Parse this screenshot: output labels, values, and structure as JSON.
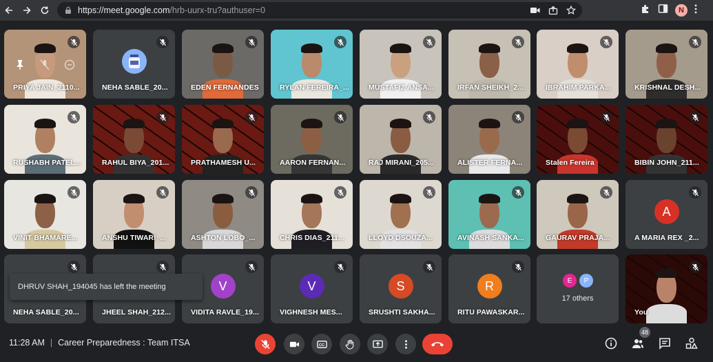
{
  "browser": {
    "url_host": "https://meet.google.com",
    "url_path": "/hrb-uurx-tru?authuser=0",
    "profile_initial": "N"
  },
  "participants": [
    {
      "name": "PRIYA JAIN_2110...",
      "bg": "#b49478",
      "skin": "#c79a7e",
      "shirt": "#eee8e0"
    },
    {
      "name": "NEHA SABLE_20...",
      "avatar": true
    },
    {
      "name": "EDEN FERNANDES",
      "bg": "#6c6a66",
      "skin": "#7b5a45",
      "shirt": "#e06a3a"
    },
    {
      "name": "RYLAN FEREIRA_...",
      "bg": "#60c5d0",
      "skin": "#b98a6b",
      "shirt": "#e9e6e0"
    },
    {
      "name": "MUSTAFIZ ANSA...",
      "bg": "#c8c4bc",
      "skin": "#c9a17f",
      "shirt": "#f0f0f0"
    },
    {
      "name": "IRFAN SHEIKH_2...",
      "bg": "#c7c0b5",
      "skin": "#8a6048",
      "shirt": "#bdb7ac"
    },
    {
      "name": "IBRAHIM PARKA...",
      "bg": "#d9cfc6",
      "skin": "#c08d6d",
      "shirt": "#e4e0da"
    },
    {
      "name": "KRISHNAL DESH...",
      "bg": "#a49b8c",
      "skin": "#8f6047",
      "shirt": "#2f2c2c"
    },
    {
      "name": "RUSHABH PATEL...",
      "bg": "#e9e5dc",
      "skin": "#b08062",
      "shirt": "#5c6e78"
    },
    {
      "name": "RAHUL BIYA_201...",
      "bg": "#6a1a12",
      "skin": "#7a4a35",
      "shirt": "#333"
    },
    {
      "name": "PRATHAMESH U...",
      "bg": "#6a1a12",
      "skin": "#9a6a4e",
      "shirt": "#222"
    },
    {
      "name": "AARON FERNAN...",
      "bg": "#6d6a60",
      "skin": "#8c5e43",
      "shirt": "#363636"
    },
    {
      "name": "RAJ MIRANI_205...",
      "bg": "#bdb6ab",
      "skin": "#8a5c42",
      "shirt": "#2a2a2a"
    },
    {
      "name": "ALISTER FERNA...",
      "bg": "#8c8478",
      "skin": "#9a6a4c",
      "shirt": "#e9e9e9"
    },
    {
      "name": "Stalen Fereira",
      "bg": "#4a0f0c",
      "skin": "#7a4a33",
      "shirt": "#c9342b"
    },
    {
      "name": "BIBIN JOHN_211...",
      "bg": "#4a0f0c",
      "skin": "#6a432e",
      "shirt": "#333"
    },
    {
      "name": "VINIT BHAMARE...",
      "bg": "#e8e6e0",
      "skin": "#8d6148",
      "shirt": "#d6c9a2"
    },
    {
      "name": "ANSHU TIWARI_...",
      "bg": "#d8cfc4",
      "skin": "#c28e70",
      "shirt": "#111"
    },
    {
      "name": "ASHTON LOBO_...",
      "bg": "#8f8b84",
      "skin": "#8a5c40",
      "shirt": "#d8d8d8"
    },
    {
      "name": "CHRIS DIAS_211...",
      "bg": "#e6e1d8",
      "skin": "#a57658",
      "shirt": "#1e1e24"
    },
    {
      "name": "LLOYD DSOUZA...",
      "bg": "#ded9d0",
      "skin": "#a07050",
      "shirt": "#e2e2e2"
    },
    {
      "name": "AVINASH SANKA...",
      "bg": "#5dc0b2",
      "skin": "#9c6a4e",
      "shirt": "#dcdcdc"
    },
    {
      "name": "GAURAV PRAJA...",
      "bg": "#cfc8bc",
      "skin": "#9a6649",
      "shirt": "#c23a2a"
    },
    {
      "name": "A MARIA REX _2...",
      "avatar": true,
      "initial": "A",
      "color": "#d93025"
    },
    {
      "name": "NEHA SABLE_20...",
      "avatar": false,
      "plain": true
    },
    {
      "name": "JHEEL SHAH_212...",
      "avatar": false,
      "plain": true
    },
    {
      "name": "VIDITA RAVLE_19...",
      "avatar": true,
      "initial": "V",
      "color": "#a142c9"
    },
    {
      "name": "VIGHNESH MES...",
      "avatar": true,
      "initial": "V",
      "color": "#5b2bb5"
    },
    {
      "name": "SRUSHTI SAKHA...",
      "avatar": true,
      "initial": "S",
      "color": "#d64a25"
    },
    {
      "name": "RITU PAWASKAR...",
      "avatar": true,
      "initial": "R",
      "color": "#f07d1e"
    },
    {
      "name": "",
      "others": true
    },
    {
      "name": "You",
      "bg": "#2a0907",
      "skin": "#b88368",
      "shirt": "#dcdcdc",
      "self": true
    }
  ],
  "others": {
    "label": "17 others",
    "initials": [
      "E",
      "P"
    ],
    "colors": [
      "#e52592",
      "#8ab4f8"
    ]
  },
  "toast": "DHRUV SHAH_194045 has left the meeting",
  "bottom": {
    "time": "11:28 AM",
    "separator": "|",
    "title": "Career Preparedness : Team ITSA",
    "participant_count": "48"
  },
  "icons": {
    "back": "back-arrow-icon",
    "forward": "forward-arrow-icon",
    "reload": "reload-icon",
    "mic_off": "mic-off-icon",
    "camera": "camera-icon",
    "captions": "captions-icon",
    "raise_hand": "raise-hand-icon",
    "present": "present-icon",
    "more": "more-vert-icon",
    "leave": "call-end-icon",
    "info": "info-icon",
    "people": "people-icon",
    "chat": "chat-icon",
    "activities": "activities-icon"
  },
  "colors": {
    "accent_red": "#ea4335",
    "background": "#202124",
    "tile": "#3c4043"
  }
}
